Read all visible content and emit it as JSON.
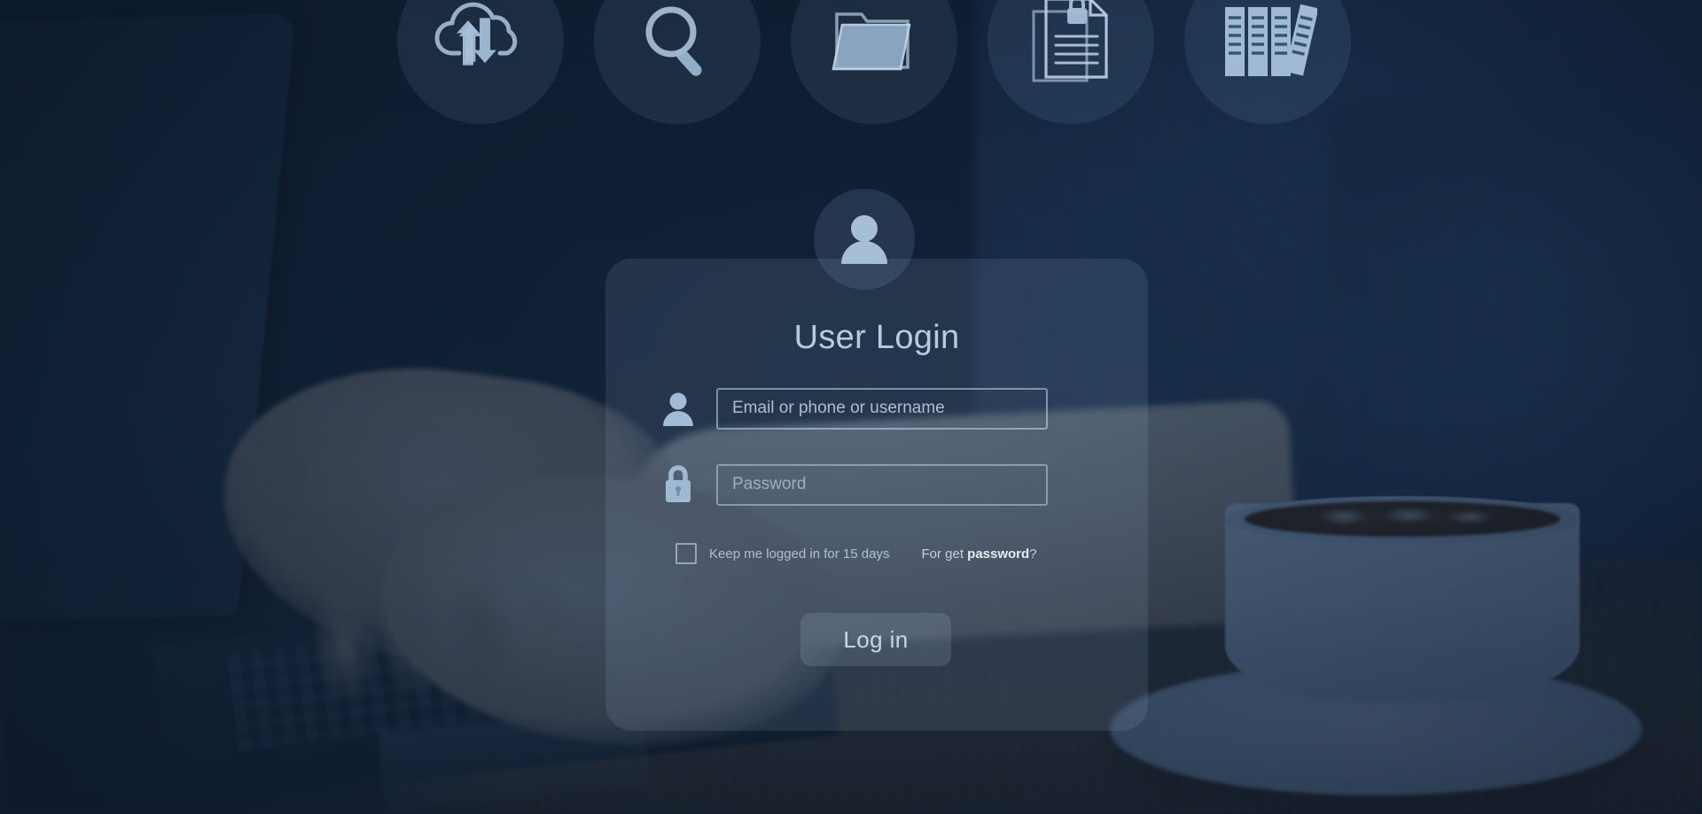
{
  "theme": {
    "overlay_color": "#1d3category",
    "background_blue": "#1e3a5c",
    "icon_tint": "#9fb8d0",
    "text_color": "#c4d8ec",
    "card_fill": "rgba(168,196,224,0.13)"
  },
  "top_icons": [
    {
      "name": "cloud-sync-icon",
      "label": "Cloud sync"
    },
    {
      "name": "search-icon",
      "label": "Search"
    },
    {
      "name": "folder-icon",
      "label": "Folder"
    },
    {
      "name": "secure-document-icon",
      "label": "Secure document"
    },
    {
      "name": "archive-binders-icon",
      "label": "Archive binders"
    }
  ],
  "login": {
    "avatar_icon": "user-avatar-icon",
    "title": "User Login",
    "username": {
      "icon": "user-icon",
      "placeholder": "Email or phone or username",
      "value": ""
    },
    "password": {
      "icon": "lock-icon",
      "placeholder": "Password",
      "value": ""
    },
    "keep_logged_in": {
      "label": "Keep me logged in for 15 days",
      "checked": false
    },
    "forget_password": {
      "prefix": "For get ",
      "emphasis": "password",
      "suffix": "?"
    },
    "submit_label": "Log in"
  },
  "background": {
    "scene": "hands typing on a laptop with a coffee cup on a wooden desk"
  }
}
